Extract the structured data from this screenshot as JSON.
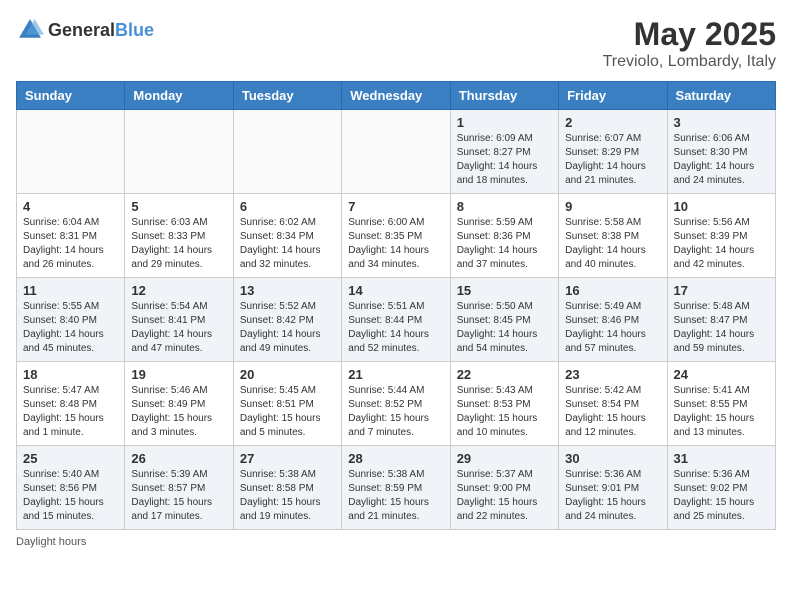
{
  "logo": {
    "general": "General",
    "blue": "Blue"
  },
  "title": {
    "month_year": "May 2025",
    "location": "Treviolo, Lombardy, Italy"
  },
  "days_of_week": [
    "Sunday",
    "Monday",
    "Tuesday",
    "Wednesday",
    "Thursday",
    "Friday",
    "Saturday"
  ],
  "weeks": [
    [
      {
        "day": "",
        "info": ""
      },
      {
        "day": "",
        "info": ""
      },
      {
        "day": "",
        "info": ""
      },
      {
        "day": "",
        "info": ""
      },
      {
        "day": "1",
        "info": "Sunrise: 6:09 AM\nSunset: 8:27 PM\nDaylight: 14 hours and 18 minutes."
      },
      {
        "day": "2",
        "info": "Sunrise: 6:07 AM\nSunset: 8:29 PM\nDaylight: 14 hours and 21 minutes."
      },
      {
        "day": "3",
        "info": "Sunrise: 6:06 AM\nSunset: 8:30 PM\nDaylight: 14 hours and 24 minutes."
      }
    ],
    [
      {
        "day": "4",
        "info": "Sunrise: 6:04 AM\nSunset: 8:31 PM\nDaylight: 14 hours and 26 minutes."
      },
      {
        "day": "5",
        "info": "Sunrise: 6:03 AM\nSunset: 8:33 PM\nDaylight: 14 hours and 29 minutes."
      },
      {
        "day": "6",
        "info": "Sunrise: 6:02 AM\nSunset: 8:34 PM\nDaylight: 14 hours and 32 minutes."
      },
      {
        "day": "7",
        "info": "Sunrise: 6:00 AM\nSunset: 8:35 PM\nDaylight: 14 hours and 34 minutes."
      },
      {
        "day": "8",
        "info": "Sunrise: 5:59 AM\nSunset: 8:36 PM\nDaylight: 14 hours and 37 minutes."
      },
      {
        "day": "9",
        "info": "Sunrise: 5:58 AM\nSunset: 8:38 PM\nDaylight: 14 hours and 40 minutes."
      },
      {
        "day": "10",
        "info": "Sunrise: 5:56 AM\nSunset: 8:39 PM\nDaylight: 14 hours and 42 minutes."
      }
    ],
    [
      {
        "day": "11",
        "info": "Sunrise: 5:55 AM\nSunset: 8:40 PM\nDaylight: 14 hours and 45 minutes."
      },
      {
        "day": "12",
        "info": "Sunrise: 5:54 AM\nSunset: 8:41 PM\nDaylight: 14 hours and 47 minutes."
      },
      {
        "day": "13",
        "info": "Sunrise: 5:52 AM\nSunset: 8:42 PM\nDaylight: 14 hours and 49 minutes."
      },
      {
        "day": "14",
        "info": "Sunrise: 5:51 AM\nSunset: 8:44 PM\nDaylight: 14 hours and 52 minutes."
      },
      {
        "day": "15",
        "info": "Sunrise: 5:50 AM\nSunset: 8:45 PM\nDaylight: 14 hours and 54 minutes."
      },
      {
        "day": "16",
        "info": "Sunrise: 5:49 AM\nSunset: 8:46 PM\nDaylight: 14 hours and 57 minutes."
      },
      {
        "day": "17",
        "info": "Sunrise: 5:48 AM\nSunset: 8:47 PM\nDaylight: 14 hours and 59 minutes."
      }
    ],
    [
      {
        "day": "18",
        "info": "Sunrise: 5:47 AM\nSunset: 8:48 PM\nDaylight: 15 hours and 1 minute."
      },
      {
        "day": "19",
        "info": "Sunrise: 5:46 AM\nSunset: 8:49 PM\nDaylight: 15 hours and 3 minutes."
      },
      {
        "day": "20",
        "info": "Sunrise: 5:45 AM\nSunset: 8:51 PM\nDaylight: 15 hours and 5 minutes."
      },
      {
        "day": "21",
        "info": "Sunrise: 5:44 AM\nSunset: 8:52 PM\nDaylight: 15 hours and 7 minutes."
      },
      {
        "day": "22",
        "info": "Sunrise: 5:43 AM\nSunset: 8:53 PM\nDaylight: 15 hours and 10 minutes."
      },
      {
        "day": "23",
        "info": "Sunrise: 5:42 AM\nSunset: 8:54 PM\nDaylight: 15 hours and 12 minutes."
      },
      {
        "day": "24",
        "info": "Sunrise: 5:41 AM\nSunset: 8:55 PM\nDaylight: 15 hours and 13 minutes."
      }
    ],
    [
      {
        "day": "25",
        "info": "Sunrise: 5:40 AM\nSunset: 8:56 PM\nDaylight: 15 hours and 15 minutes."
      },
      {
        "day": "26",
        "info": "Sunrise: 5:39 AM\nSunset: 8:57 PM\nDaylight: 15 hours and 17 minutes."
      },
      {
        "day": "27",
        "info": "Sunrise: 5:38 AM\nSunset: 8:58 PM\nDaylight: 15 hours and 19 minutes."
      },
      {
        "day": "28",
        "info": "Sunrise: 5:38 AM\nSunset: 8:59 PM\nDaylight: 15 hours and 21 minutes."
      },
      {
        "day": "29",
        "info": "Sunrise: 5:37 AM\nSunset: 9:00 PM\nDaylight: 15 hours and 22 minutes."
      },
      {
        "day": "30",
        "info": "Sunrise: 5:36 AM\nSunset: 9:01 PM\nDaylight: 15 hours and 24 minutes."
      },
      {
        "day": "31",
        "info": "Sunrise: 5:36 AM\nSunset: 9:02 PM\nDaylight: 15 hours and 25 minutes."
      }
    ]
  ],
  "footer": {
    "note": "Daylight hours"
  }
}
